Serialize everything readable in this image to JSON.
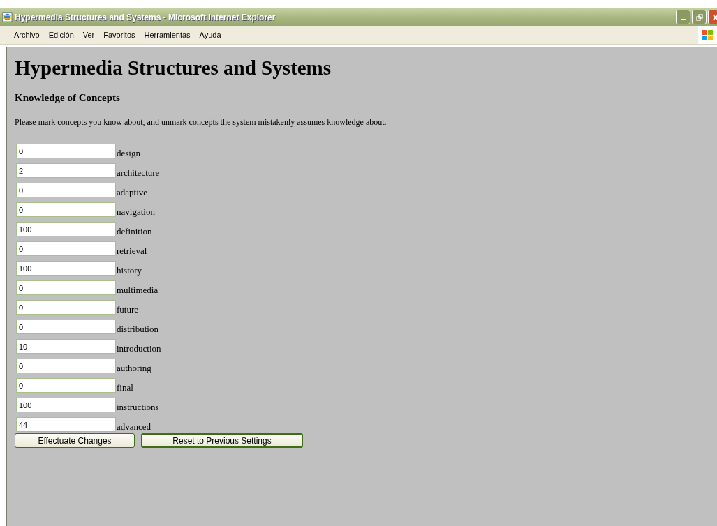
{
  "window": {
    "title": "Hypermedia Structures and Systems - Microsoft Internet Explorer"
  },
  "menu": [
    "Archivo",
    "Edición",
    "Ver",
    "Favoritos",
    "Herramientas",
    "Ayuda"
  ],
  "page": {
    "title": "Hypermedia Structures and Systems",
    "subtitle": "Knowledge of Concepts",
    "instructions": "Please mark concepts you know about, and unmark concepts the system mistakenly assumes knowledge about."
  },
  "concepts": [
    {
      "value": "0",
      "label": "design"
    },
    {
      "value": "2",
      "label": "architecture"
    },
    {
      "value": "0",
      "label": "adaptive"
    },
    {
      "value": "0",
      "label": "navigation"
    },
    {
      "value": "100",
      "label": "definition"
    },
    {
      "value": "0",
      "label": "retrieval"
    },
    {
      "value": "100",
      "label": "history"
    },
    {
      "value": "0",
      "label": "multimedia"
    },
    {
      "value": "0",
      "label": "future"
    },
    {
      "value": "0",
      "label": "distribution"
    },
    {
      "value": "10",
      "label": "introduction"
    },
    {
      "value": "0",
      "label": "authoring"
    },
    {
      "value": "0",
      "label": "final"
    },
    {
      "value": "100",
      "label": "instructions"
    },
    {
      "value": "44",
      "label": "advanced"
    }
  ],
  "buttons": [
    "Effectuate Changes",
    "Reset to Previous Settings"
  ]
}
